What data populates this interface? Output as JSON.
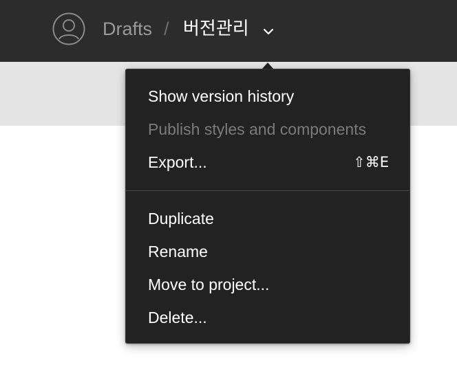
{
  "header": {
    "breadcrumb_parent": "Drafts",
    "breadcrumb_separator": "/",
    "file_name": "버전관리",
    "avatar_icon": "user-avatar-icon",
    "chevron_icon": "chevron-down-icon"
  },
  "menu": {
    "items": [
      {
        "label": "Show version history",
        "enabled": true
      },
      {
        "label": "Publish styles and components",
        "enabled": false
      },
      {
        "label": "Export...",
        "shortcut": "⇧⌘E",
        "enabled": true
      },
      {
        "label": "Duplicate",
        "enabled": true
      },
      {
        "label": "Rename",
        "enabled": true
      },
      {
        "label": "Move to project...",
        "enabled": true
      },
      {
        "label": "Delete...",
        "enabled": true
      }
    ]
  },
  "colors": {
    "topbar_bg": "#2c2c2c",
    "subbar_bg": "#e5e5e5",
    "menu_bg": "#222222",
    "text_primary": "#ffffff",
    "text_disabled": "#7b7b7b",
    "text_muted": "#9a9a9a"
  }
}
